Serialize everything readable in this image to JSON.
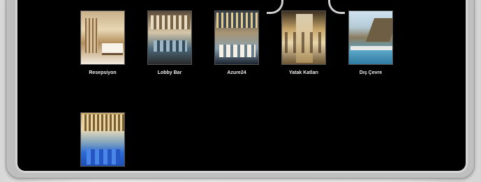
{
  "gallery": {
    "items": [
      {
        "label": "Resepsiyon"
      },
      {
        "label": "Lobby Bar"
      },
      {
        "label": "Azure24"
      },
      {
        "label": "Yatak Katları"
      },
      {
        "label": "Dış Çevre"
      },
      {
        "label": ""
      }
    ]
  },
  "colors": {
    "panel_background": "#000000",
    "frame": "#d4d4d4",
    "caption_text": "#f0f0f0"
  }
}
